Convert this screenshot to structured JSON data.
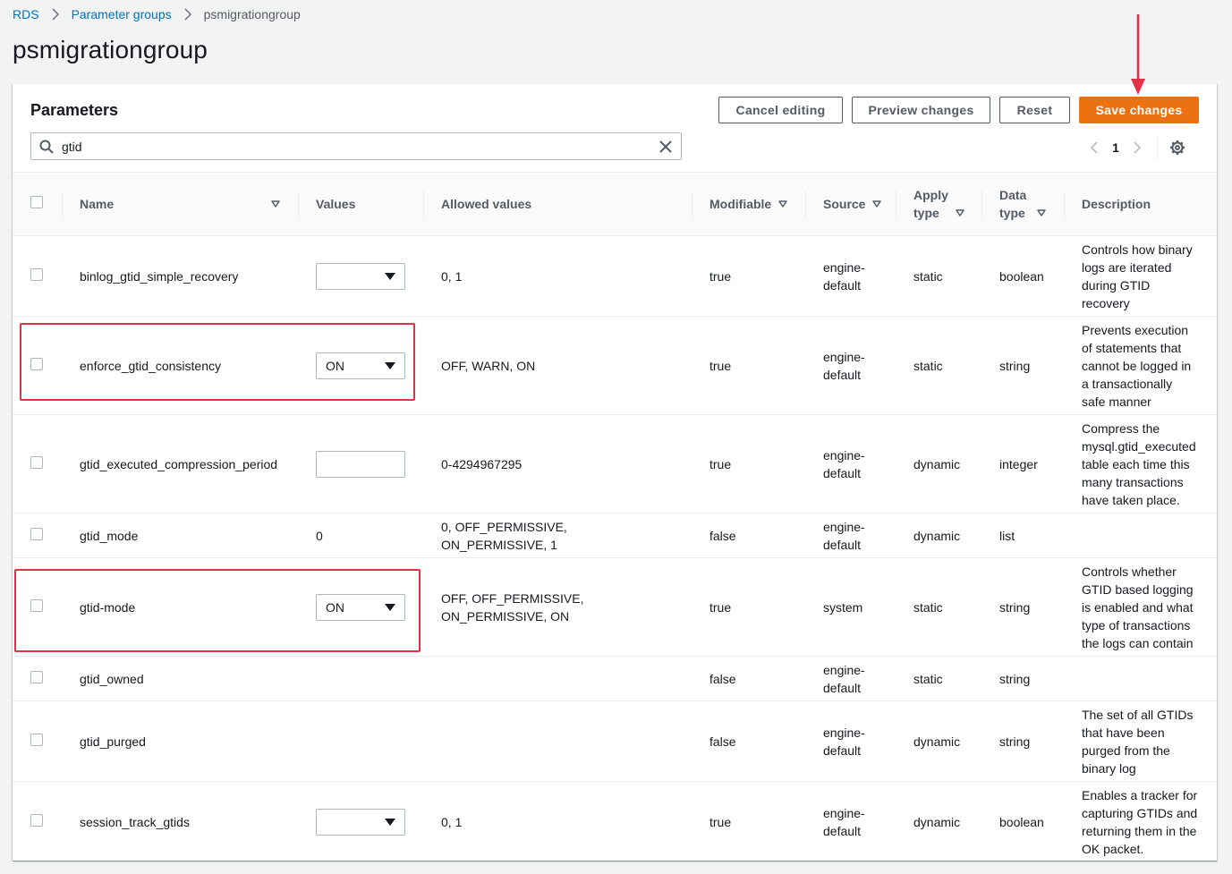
{
  "breadcrumb": {
    "items": [
      "RDS",
      "Parameter groups"
    ],
    "current": "psmigrationgroup"
  },
  "page": {
    "title": "psmigrationgroup"
  },
  "panel": {
    "title": "Parameters",
    "buttons": {
      "cancel": "Cancel editing",
      "preview": "Preview changes",
      "reset": "Reset",
      "save": "Save changes"
    },
    "search": {
      "value": "gtid"
    },
    "pagination": {
      "page": "1"
    }
  },
  "table": {
    "headers": {
      "name": "Name",
      "values": "Values",
      "allowed": "Allowed values",
      "modifiable": "Modifiable",
      "source": "Source",
      "apply_type": "Apply type",
      "data_type": "Data type",
      "description": "Description"
    },
    "rows": [
      {
        "name": "binlog_gtid_simple_recovery",
        "value": "",
        "allowed": "0, 1",
        "modifiable": "true",
        "source": "engine-default",
        "apply_type": "static",
        "data_type": "boolean",
        "description": "Controls how binary logs are iterated during GTID recovery"
      },
      {
        "name": "enforce_gtid_consistency",
        "value": "ON",
        "allowed": "OFF, WARN, ON",
        "modifiable": "true",
        "source": "engine-default",
        "apply_type": "static",
        "data_type": "string",
        "description": "Prevents execution of statements that cannot be logged in a transactionally safe manner"
      },
      {
        "name": "gtid_executed_compression_period",
        "value": "",
        "allowed": "0-4294967295",
        "modifiable": "true",
        "source": "engine-default",
        "apply_type": "dynamic",
        "data_type": "integer",
        "description": "Compress the mysql.gtid_executed table each time this many transactions have taken place."
      },
      {
        "name": "gtid_mode",
        "value": "0",
        "allowed": "0, OFF_PERMISSIVE, ON_PERMISSIVE, 1",
        "modifiable": "false",
        "source": "engine-default",
        "apply_type": "dynamic",
        "data_type": "list",
        "description": ""
      },
      {
        "name": "gtid-mode",
        "value": "ON",
        "allowed": "OFF, OFF_PERMISSIVE, ON_PERMISSIVE, ON",
        "modifiable": "true",
        "source": "system",
        "apply_type": "static",
        "data_type": "string",
        "description": "Controls whether GTID based logging is enabled and what type of transactions the logs can contain"
      },
      {
        "name": "gtid_owned",
        "value": "",
        "allowed": "",
        "modifiable": "false",
        "source": "engine-default",
        "apply_type": "static",
        "data_type": "string",
        "description": ""
      },
      {
        "name": "gtid_purged",
        "value": "",
        "allowed": "",
        "modifiable": "false",
        "source": "engine-default",
        "apply_type": "dynamic",
        "data_type": "string",
        "description": "The set of all GTIDs that have been purged from the binary log"
      },
      {
        "name": "session_track_gtids",
        "value": "",
        "allowed": "0, 1",
        "modifiable": "true",
        "source": "engine-default",
        "apply_type": "dynamic",
        "data_type": "boolean",
        "description": "Enables a tracker for capturing GTIDs and returning them in the OK packet."
      }
    ]
  },
  "colors": {
    "accent": "#ec7211",
    "link": "#0073bb",
    "annotation": "#e3314b"
  }
}
